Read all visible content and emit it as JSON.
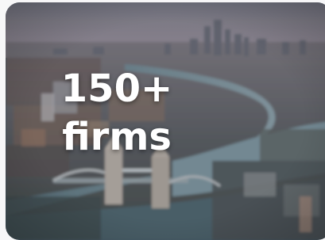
{
  "stat_card": {
    "value": "150+",
    "label": "firms",
    "image": "london-skyline-thames-photo"
  }
}
